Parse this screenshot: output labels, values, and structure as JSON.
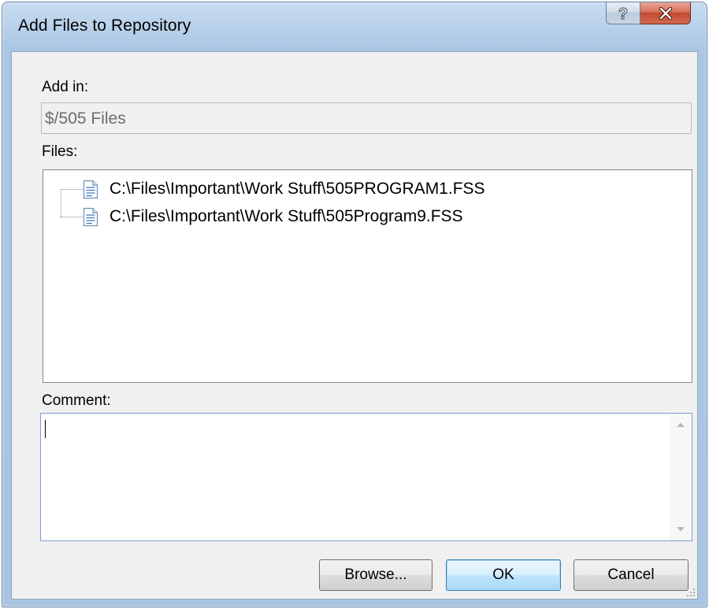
{
  "window": {
    "title": "Add Files to Repository",
    "help_icon": "help-question-icon",
    "close_icon": "close-x-icon"
  },
  "add_in": {
    "label": "Add in:",
    "value": "$/505 Files"
  },
  "files": {
    "label": "Files:",
    "items": [
      {
        "path": "C:\\Files\\Important\\Work Stuff\\505PROGRAM1.FSS",
        "icon": "document-icon"
      },
      {
        "path": "C:\\Files\\Important\\Work Stuff\\505Program9.FSS",
        "icon": "document-icon"
      }
    ]
  },
  "comment": {
    "label": "Comment:",
    "value": ""
  },
  "buttons": {
    "browse": "Browse...",
    "ok": "OK",
    "cancel": "Cancel"
  },
  "colors": {
    "title_bar": "#b9d1ea",
    "close_button": "#c34a32",
    "dialog_bg": "#f0f0f0",
    "default_button_border": "#3c7fb1"
  }
}
